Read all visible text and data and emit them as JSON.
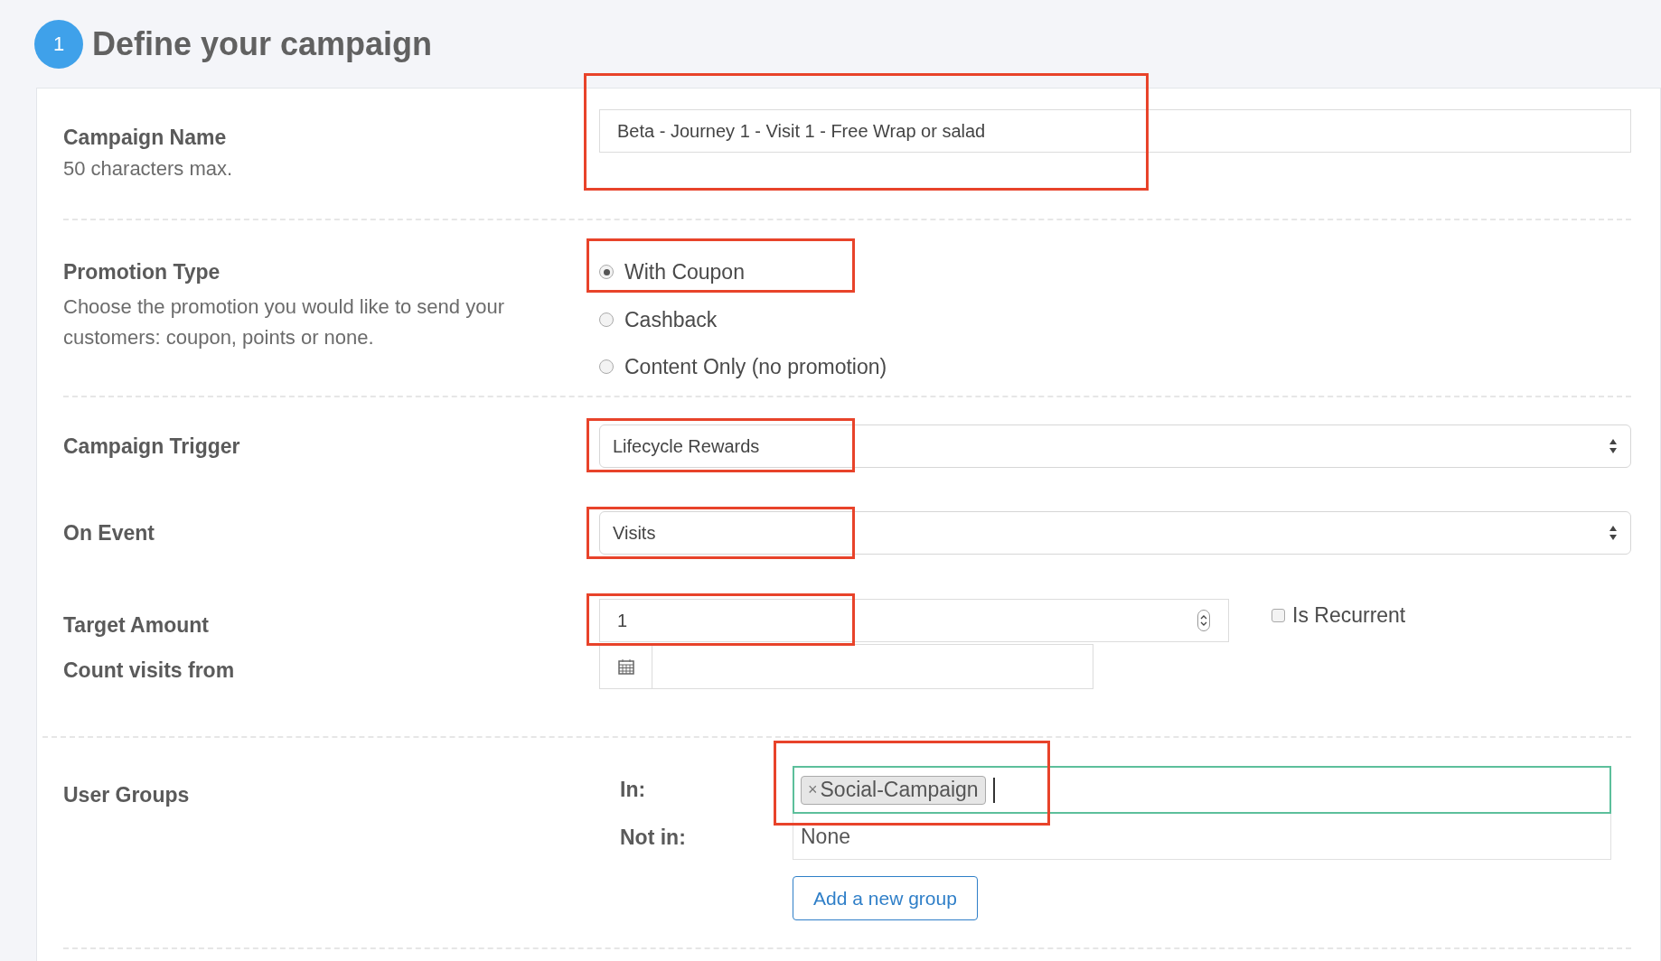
{
  "header": {
    "step": "1",
    "title": "Define your campaign"
  },
  "campaign_name": {
    "label": "Campaign Name",
    "hint": "50 characters max.",
    "value": "Beta - Journey 1 - Visit 1 - Free Wrap or salad"
  },
  "promotion_type": {
    "label": "Promotion Type",
    "description": "Choose the promotion you would like to send your customers: coupon, points or none.",
    "options": [
      {
        "label": "With Coupon",
        "selected": true
      },
      {
        "label": "Cashback",
        "selected": false
      },
      {
        "label": "Content Only (no promotion)",
        "selected": false
      }
    ]
  },
  "campaign_trigger": {
    "label": "Campaign Trigger",
    "value": "Lifecycle Rewards"
  },
  "on_event": {
    "label": "On Event",
    "value": "Visits"
  },
  "target_amount": {
    "label": "Target Amount",
    "value": "1"
  },
  "is_recurrent": {
    "label": "Is Recurrent",
    "checked": false
  },
  "count_visits_from": {
    "label": "Count visits from"
  },
  "user_groups": {
    "label": "User Groups",
    "in_label": "In:",
    "in_tags": [
      {
        "remove": "×",
        "label": "Social-Campaign"
      }
    ],
    "not_in_label": "Not in:",
    "not_in_value": "None",
    "add_button": "Add a new group"
  }
}
